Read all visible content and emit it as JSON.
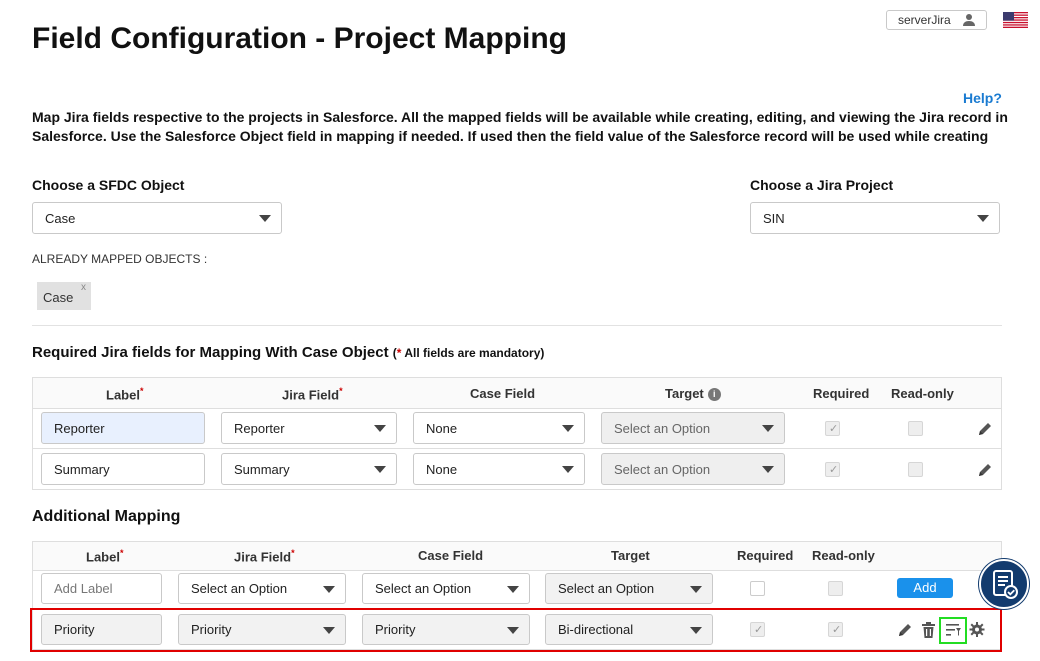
{
  "page": {
    "title": "Field Configuration - Project Mapping",
    "user": "serverJira",
    "help": "Help?",
    "description": "Map Jira fields respective to the projects in Salesforce. All the mapped fields will be available while creating, editing, and viewing the Jira record in Salesforce. Use the Salesforce Object field in mapping if needed. If used then the field value of the Salesforce record will be used while creating Jira"
  },
  "sfdc": {
    "label": "Choose a SFDC Object",
    "value": "Case"
  },
  "jira_project": {
    "label": "Choose a Jira Project",
    "value": "SIN"
  },
  "already_mapped": {
    "label": "ALREADY MAPPED OBJECTS :",
    "chips": [
      "Case"
    ],
    "chip_close": "x"
  },
  "required_section": {
    "heading": "Required Jira fields for Mapping With Case Object",
    "note_star": "*",
    "note": " All fields are mandatory)",
    "note_open": "(",
    "columns": {
      "label": "Label",
      "jira_field": "Jira Field",
      "case_field": "Case Field",
      "target": "Target",
      "required": "Required",
      "readonly": "Read-only"
    },
    "star": "*",
    "rows": [
      {
        "label": "Reporter",
        "jira_field": "Reporter",
        "case_field": "None",
        "target": "Select an Option",
        "required": true,
        "readonly": false
      },
      {
        "label": "Summary",
        "jira_field": "Summary",
        "case_field": "None",
        "target": "Select an Option",
        "required": true,
        "readonly": false
      }
    ]
  },
  "additional_section": {
    "heading": "Additional Mapping",
    "columns": {
      "label": "Label",
      "jira_field": "Jira Field",
      "case_field": "Case Field",
      "target": "Target",
      "required": "Required",
      "readonly": "Read-only"
    },
    "new_row": {
      "label_placeholder": "Add Label",
      "jira_field": "Select an Option",
      "case_field": "Select an Option",
      "target": "Select an Option",
      "add_button": "Add"
    },
    "rows": [
      {
        "label": "Priority",
        "jira_field": "Priority",
        "case_field": "Priority",
        "target": "Bi-directional",
        "required": true,
        "readonly": true
      }
    ]
  },
  "icons": [
    "user-icon",
    "us-flag-icon",
    "pencil-icon",
    "trash-icon",
    "filter-mapping-icon",
    "gear-icon",
    "document-check-icon"
  ],
  "colors": {
    "accent": "#1a91eb",
    "highlight_red": "#e00000",
    "highlight_green": "#22dd22",
    "float_button": "#123b6e"
  }
}
